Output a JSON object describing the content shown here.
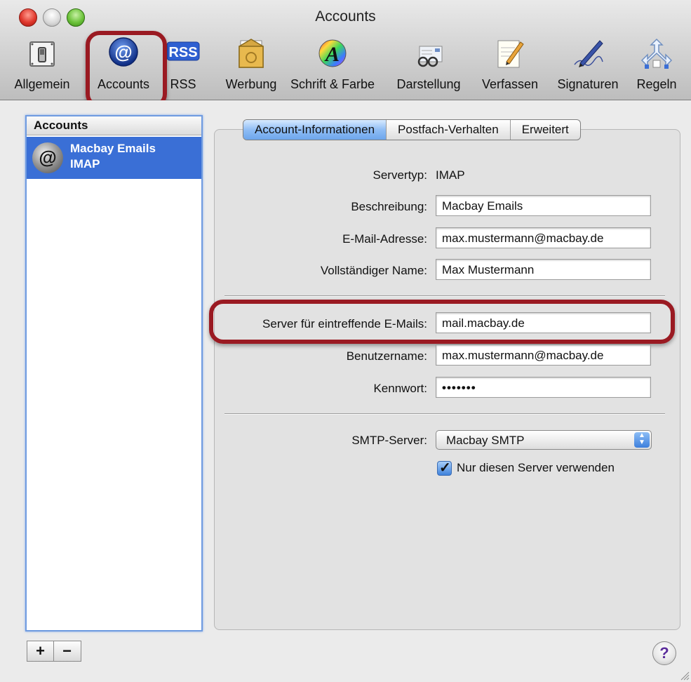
{
  "window": {
    "title": "Accounts"
  },
  "toolbar": {
    "items": [
      {
        "label": "Allgemein",
        "icon": "switch-icon"
      },
      {
        "label": "Accounts",
        "icon": "at-sign-icon"
      },
      {
        "label": "RSS",
        "icon": "rss-icon"
      },
      {
        "label": "Werbung",
        "icon": "junk-mail-icon"
      },
      {
        "label": "Schrift & Farbe",
        "icon": "font-color-icon"
      },
      {
        "label": "Darstellung",
        "icon": "viewing-glasses-icon"
      },
      {
        "label": "Verfassen",
        "icon": "compose-pencil-icon"
      },
      {
        "label": "Signaturen",
        "icon": "signature-pen-icon"
      },
      {
        "label": "Regeln",
        "icon": "rules-icon"
      }
    ],
    "rss_badge": "RSS",
    "at_symbol": "@",
    "font_symbol": "A"
  },
  "sidebar": {
    "header": "Accounts",
    "accounts": [
      {
        "name": "Macbay Emails",
        "type": "IMAP"
      }
    ],
    "add_label": "+",
    "remove_label": "−"
  },
  "tabs": [
    {
      "label": "Account-Informationen",
      "active": true
    },
    {
      "label": "Postfach-Verhalten",
      "active": false
    },
    {
      "label": "Erweitert",
      "active": false
    }
  ],
  "form": {
    "server_type_label": "Servertyp:",
    "server_type_value": "IMAP",
    "description_label": "Beschreibung:",
    "description_value": "Macbay Emails",
    "email_label": "E-Mail-Adresse:",
    "email_value": "max.mustermann@macbay.de",
    "fullname_label": "Vollständiger Name:",
    "fullname_value": "Max Mustermann",
    "incoming_label": "Server für eintreffende E-Mails:",
    "incoming_value": "mail.macbay.de",
    "username_label": "Benutzername:",
    "username_value": "max.mustermann@macbay.de",
    "password_label": "Kennwort:",
    "password_value": "•••••••",
    "smtp_label": "SMTP-Server:",
    "smtp_value": "Macbay SMTP",
    "only_server_label": "Nur diesen Server verwenden",
    "only_server_checked": true
  },
  "help_label": "?",
  "colors": {
    "highlight": "#9a1a22",
    "selection": "#3a6fd6",
    "tab_active": "#8fbdf5"
  }
}
